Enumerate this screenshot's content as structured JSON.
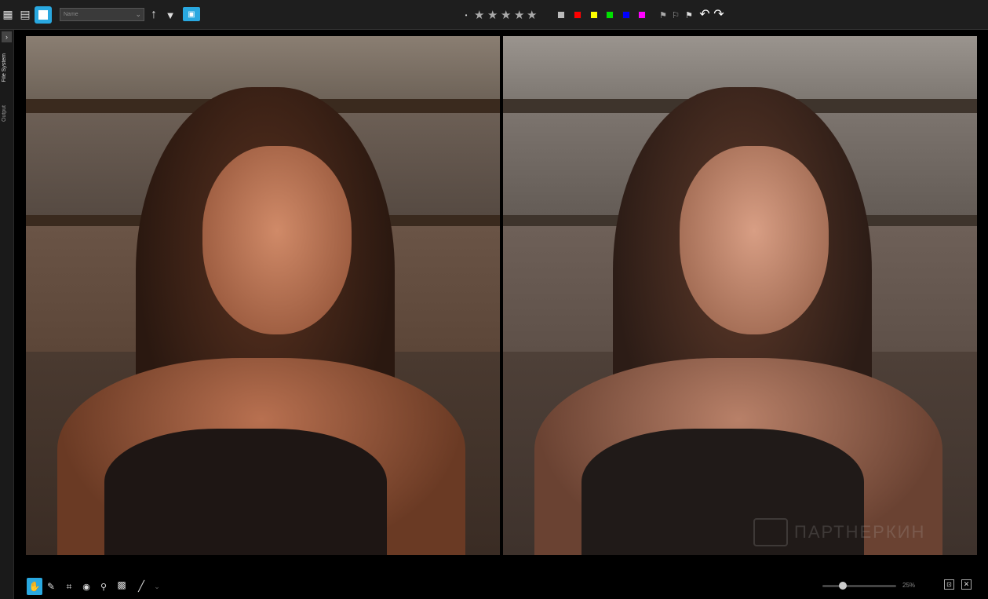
{
  "toolbar": {
    "sort_dropdown": {
      "value": "Name"
    },
    "rating_stars": 5,
    "color_labels": [
      "#bbbbbb",
      "#ff0000",
      "#ffff00",
      "#00e000",
      "#0000ff",
      "#ff00ff"
    ],
    "accent": "#29a8e0"
  },
  "sidebar": {
    "tabs": [
      {
        "label": "File System"
      },
      {
        "label": "Output"
      }
    ]
  },
  "bottombar": {
    "zoom_label": "25%",
    "zoom_value": 25
  },
  "watermark": "ПАРТНЕРКИН"
}
